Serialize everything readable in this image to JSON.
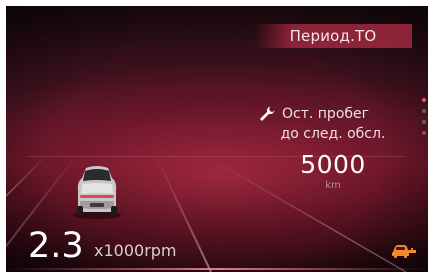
{
  "header": {
    "title": "Период.ТО"
  },
  "service_info": {
    "line1": "Ост. пробег",
    "line2": "до след. обсл.",
    "value": "5000",
    "unit": "km",
    "icon": "wrench-icon"
  },
  "rpm": {
    "value": "2.3",
    "unit": "x1000rpm"
  },
  "pagination": {
    "total": 4,
    "active_index": 0
  },
  "indicators": {
    "warning_icon": "car-key-warning-icon",
    "warning_color": "#f08a22"
  },
  "colors": {
    "background": "#4a1220",
    "accent": "#e2506a",
    "banner": "#a0283e"
  }
}
